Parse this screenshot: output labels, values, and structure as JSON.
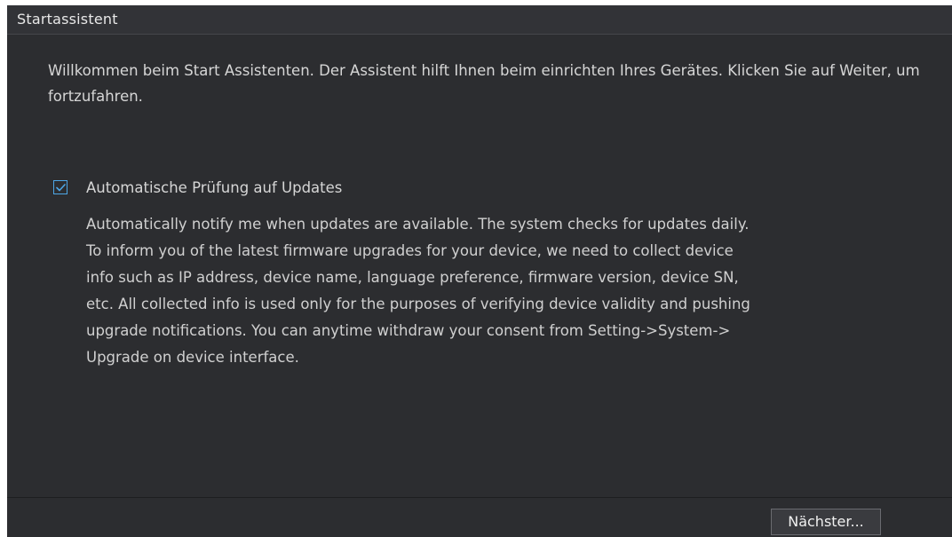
{
  "window": {
    "title": "Startassistent"
  },
  "main": {
    "welcome_text": "Willkommen beim Start Assistenten. Der Assistent hilft Ihnen beim einrichten Ihres Gerätes. Klicken Sie auf Weiter, um fortzufahren.",
    "auto_update": {
      "checked": true,
      "label": "Automatische Prüfung auf Updates",
      "description": "Automatically notify me when updates are available. The system checks for updates daily.\nTo inform you of the latest firmware upgrades for your device, we need to collect device\ninfo such as IP address, device name, language preference, firmware version, device SN,\netc. All collected info is used only for the purposes of verifying device validity and pushing\nupgrade notifications. You can anytime withdraw your consent from Setting->System->\nUpgrade on device interface."
    }
  },
  "footer": {
    "next_label": "Nächster..."
  },
  "colors": {
    "panel_background": "#2c2d30",
    "titlebar_background": "#323337",
    "checkbox_accent": "#4da6e6",
    "text": "#d6d6d6"
  },
  "icons": {
    "checkbox": "checkmark-icon"
  }
}
